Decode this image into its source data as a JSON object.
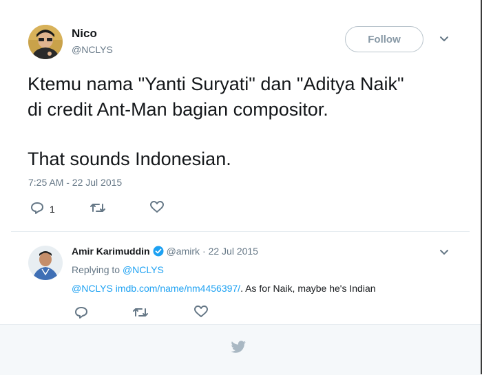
{
  "tweet": {
    "author_name": "Nico",
    "author_handle": "@NCLYS",
    "follow_label": "Follow",
    "text_line1": "Ktemu nama \"Yanti Suryati\" dan \"Aditya Naik\"",
    "text_line2": "di credit Ant-Man bagian compositor.",
    "text_line3": "That sounds Indonesian.",
    "timestamp": "7:25 AM - 22 Jul 2015",
    "reply_count": "1"
  },
  "reply": {
    "author_name": "Amir Karimuddin",
    "author_handle": "@amirk",
    "date": "· 22 Jul 2015",
    "replying_to_prefix": "Replying to",
    "replying_to_handle": "@NCLYS",
    "mention": "@NCLYS",
    "link": "imdb.com/name/nm4456397/",
    "text_rest": ". As for Naik, maybe he's Indian"
  },
  "colors": {
    "accent": "#1da1f2",
    "muted": "#657786",
    "border": "#e6ecf0",
    "footer_bg": "#f5f8fa"
  },
  "icons": [
    "chevron-down-icon",
    "reply-icon",
    "retweet-icon",
    "like-icon",
    "verified-icon",
    "twitter-bird-icon"
  ]
}
